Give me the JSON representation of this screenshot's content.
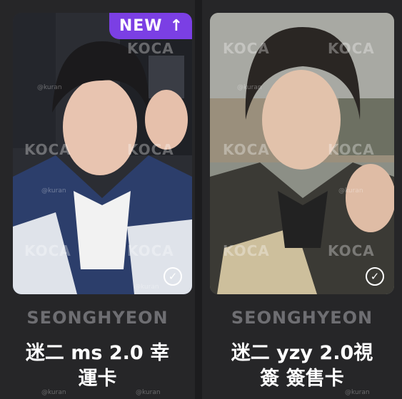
{
  "cards": [
    {
      "badge": {
        "label": "NEW",
        "icon": "arrow-up-icon",
        "arrow": "↑",
        "color": "#7b3fe4"
      },
      "member": "SEONGHYEON",
      "title_line1": "迷二 ms 2.0 幸",
      "title_line2": "運卡",
      "watermark": "KOCA",
      "watermark_small": "@kuran",
      "selected_icon": "check-circle-icon",
      "selected_glyph": "✓"
    },
    {
      "member": "SEONGHYEON",
      "title_line1": "迷二 yzy 2.0視",
      "title_line2": "簽 簽售卡",
      "watermark": "KOCA",
      "watermark_small": "@kuran",
      "selected_icon": "check-circle-icon",
      "selected_glyph": "✓"
    }
  ]
}
